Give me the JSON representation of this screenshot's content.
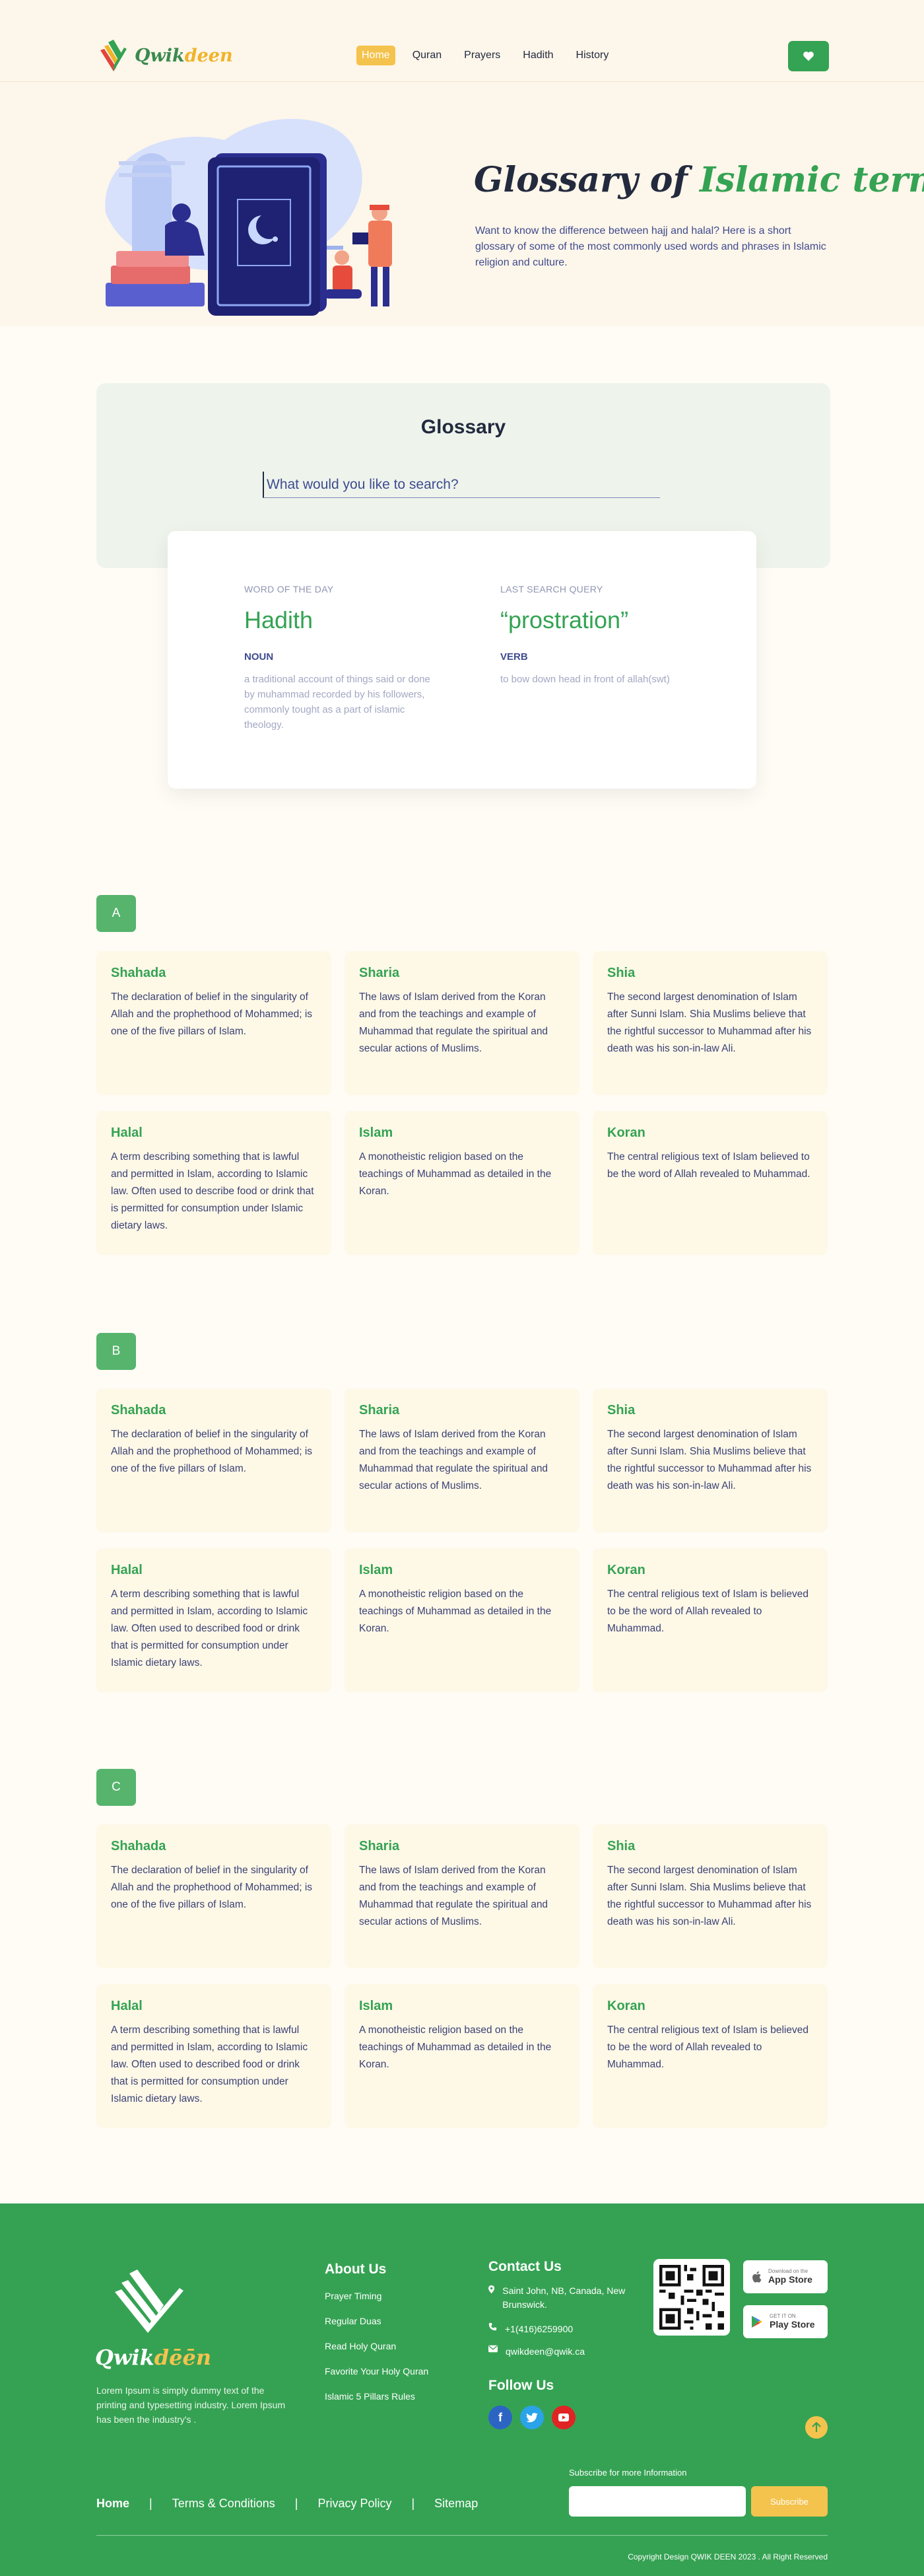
{
  "brand": {
    "name_a": "Qwik",
    "name_b": "deen"
  },
  "nav": {
    "items": [
      "Home",
      "Quran",
      "Prayers",
      "Hadith",
      "History"
    ],
    "active": "Home"
  },
  "hero": {
    "title_a": "Glossary of ",
    "title_b": "Islamic terms",
    "description": "Want to know the difference between hajj and halal? Here is a short glossary of some of the most commonly used words and phrases in Islamic religion and culture."
  },
  "glossary": {
    "title": "Glossary",
    "search_placeholder": "What would you like to search?"
  },
  "word_of_day": {
    "caption": "WORD OF THE DAY",
    "word": "Hadith",
    "pos": "NOUN",
    "definition": "a traditional account of things said or done by muhammad recorded by his followers, commonly tought as a part of islamic theology."
  },
  "last_search": {
    "caption": "LAST SEARCH QUERY",
    "word": "“prostration”",
    "pos": "VERB",
    "definition": "to bow down head in front of allah(swt)"
  },
  "sections": [
    {
      "letter": "A",
      "cards": [
        {
          "title": "Shahada",
          "desc": "The declaration of belief in the singularity of Allah and the prophethood of Mohammed; is one of the five pillars of Islam."
        },
        {
          "title": "Sharia",
          "desc": "The laws of Islam derived from the Koran and from the teachings and example of Muhammad that regulate the spiritual and secular actions of Muslims."
        },
        {
          "title": "Shia",
          "desc": "The second largest denomination of Islam after Sunni Islam. Shia Muslims believe that the rightful successor to Muhammad after his death was his son-in-law Ali."
        },
        {
          "title": "Halal",
          "desc": "A term describing something that is lawful and permitted in Islam, according to Islamic law. Often used to describe food or drink that is permitted for consumption under Islamic dietary laws."
        },
        {
          "title": "Islam",
          "desc": "A monotheistic religion based on the teachings of Muhammad as detailed in the Koran."
        },
        {
          "title": "Koran",
          "desc": "The central religious text of Islam believed to be the word of Allah revealed to Muhammad."
        }
      ]
    },
    {
      "letter": "B",
      "cards": [
        {
          "title": "Shahada",
          "desc": "The declaration of belief in the singularity of Allah and the prophethood of Mohammed; is one of the five pillars of Islam."
        },
        {
          "title": "Sharia",
          "desc": "The laws of Islam derived from the Koran and from the teachings and example of Muhammad that regulate the spiritual and secular actions of Muslims."
        },
        {
          "title": "Shia",
          "desc": "The second largest denomination of Islam after Sunni Islam. Shia Muslims believe that the rightful successor to Muhammad after his death was his son-in-law Ali."
        },
        {
          "title": "Halal",
          "desc": "A term describing something that is lawful and permitted in Islam, according to Islamic law. Often used to described food or drink that is permitted for consumption under Islamic dietary laws."
        },
        {
          "title": "Islam",
          "desc": "A monotheistic religion based on the teachings of Muhammad as detailed in the Koran."
        },
        {
          "title": "Koran",
          "desc": "The central religious text of Islam is believed to be the word of Allah revealed to Muhammad."
        }
      ]
    },
    {
      "letter": "C",
      "cards": [
        {
          "title": "Shahada",
          "desc": "The declaration of belief in the singularity of Allah and the prophethood of Mohammed; is one of the five pillars of Islam."
        },
        {
          "title": "Sharia",
          "desc": "The laws of Islam derived from the Koran and from the teachings and example of Muhammad that regulate the spiritual and secular actions of Muslims."
        },
        {
          "title": "Shia",
          "desc": "The second largest denomination of Islam after Sunni Islam. Shia Muslims believe that the rightful successor to Muhammad after his death was his son-in-law Ali."
        },
        {
          "title": "Halal",
          "desc": "A term describing something that is lawful and permitted in Islam, according to Islamic law. Often used to described food or drink that is permitted for consumption under Islamic dietary laws."
        },
        {
          "title": "Islam",
          "desc": "A monotheistic religion based on the teachings of Muhammad as detailed in the Koran."
        },
        {
          "title": "Koran",
          "desc": "The central religious text of Islam is believed to be the word of Allah revealed to Muhammad."
        }
      ]
    }
  ],
  "footer": {
    "brand_a": "Qwik",
    "brand_b": "dēēn",
    "description": "Lorem Ipsum is simply dummy text of the printing and typesetting industry.  Lorem Ipsum has been the industry's .",
    "about_title": "About Us",
    "about_links": [
      "Prayer Timing",
      "Regular Duas",
      "Read Holy Quran",
      "Favorite Your Holy Quran",
      "Islamic 5 Pillars Rules"
    ],
    "contact_title": "Contact Us",
    "address": "Saint John, NB, Canada, New Brunswick.",
    "phone": "+1(416)6259900",
    "email": "qwikdeen@qwik.ca",
    "follow_title": "Follow Us",
    "app_store_small": "Download on the",
    "app_store": "App Store",
    "play_store_small": "GET IT ON",
    "play_store": "Play Store",
    "subscribe_caption": "Subscribe for more Information",
    "subscribe_button": "Subscribe",
    "bottom_links": [
      "Home",
      "Terms & Conditions",
      "Privacy Policy",
      "Sitemap"
    ],
    "copyright": "Copyright Design QWIK DEEN 2023 . All Right Reserved"
  },
  "colors": {
    "green": "#34a353",
    "yellow": "#f4c34d",
    "navy": "#232a3e",
    "cream": "#fdf6ea"
  }
}
